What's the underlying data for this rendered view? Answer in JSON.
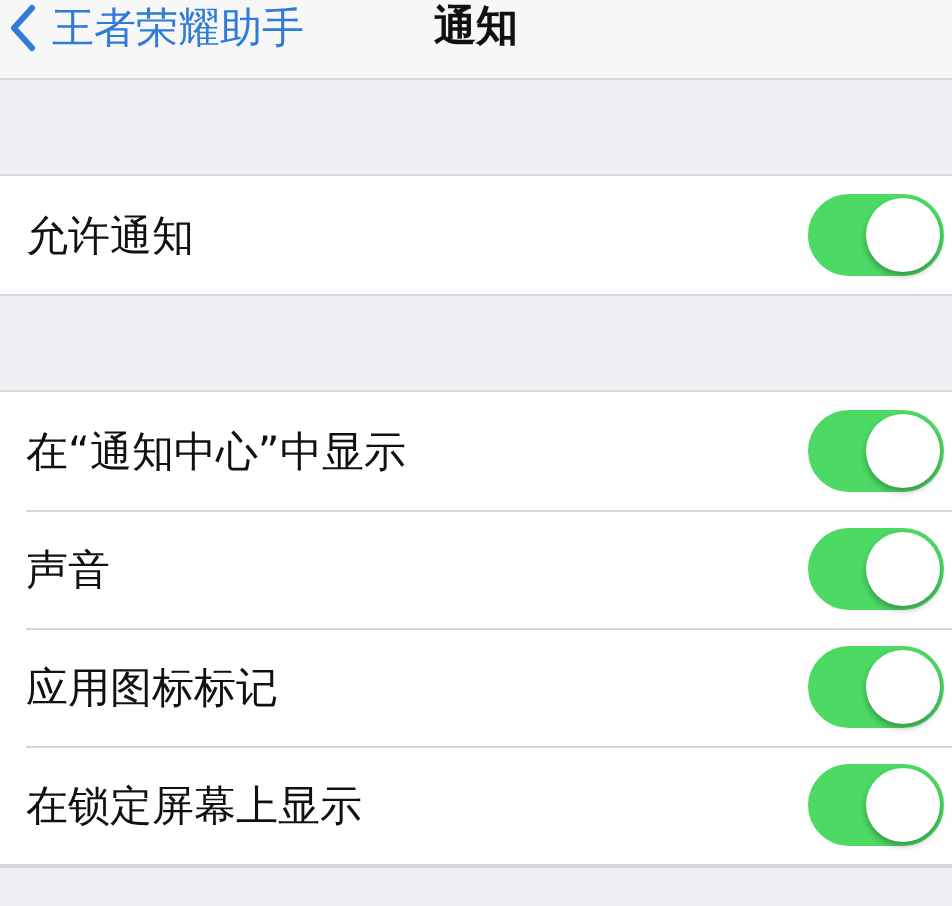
{
  "nav": {
    "back": "王者荣耀助手",
    "title": "通知"
  },
  "groups": [
    {
      "rows": [
        {
          "label": "允许通知",
          "on": true
        }
      ]
    },
    {
      "rows": [
        {
          "label": "在“通知中心”中显示",
          "on": true
        },
        {
          "label": "声音",
          "on": true
        },
        {
          "label": "应用图标标记",
          "on": true
        },
        {
          "label": "在锁定屏幕上显示",
          "on": true
        }
      ]
    }
  ]
}
